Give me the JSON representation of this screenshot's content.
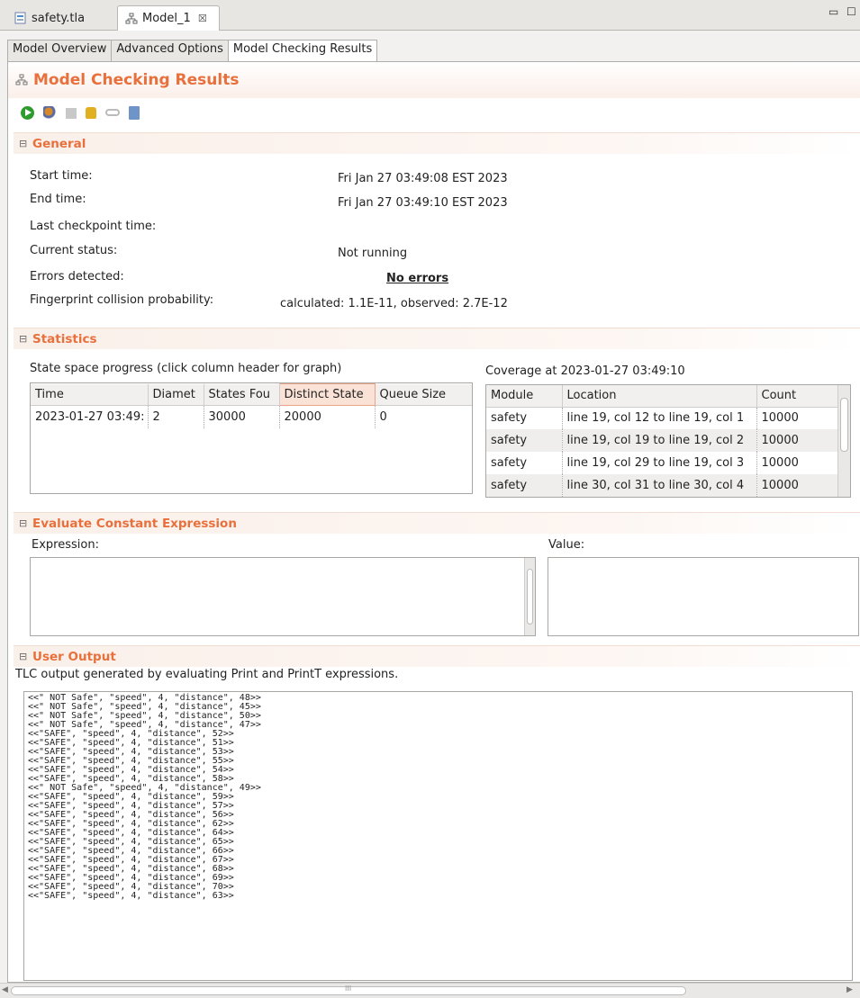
{
  "editor_tabs": [
    {
      "label": "safety.tla",
      "icon": "tla-file-icon"
    },
    {
      "label": "Model_1",
      "icon": "model-icon",
      "close": "☒"
    }
  ],
  "window_controls": {
    "minimize": "▭",
    "maximize": "☐"
  },
  "page_tabs": [
    "Model Overview",
    "Advanced Options",
    "Model Checking Results"
  ],
  "form_title": "Model Checking Results",
  "toolbar": [
    "run-icon",
    "gears-icon",
    "stop-icon",
    "lock-icon",
    "key-icon",
    "report-icon"
  ],
  "general": {
    "title": "General",
    "start_time_label": "Start time:",
    "start_time": "Fri Jan 27 03:49:08 EST 2023",
    "end_time_label": "End time:",
    "end_time": "Fri Jan 27 03:49:10 EST 2023",
    "last_checkpoint_label": "Last checkpoint time:",
    "current_status_label": "Current status:",
    "current_status": "Not running",
    "errors_label": "Errors detected:",
    "errors": "No errors",
    "fingerprint_label": "Fingerprint collision probability:",
    "fingerprint": "calculated: 1.1E-11,  observed: 2.7E-12"
  },
  "statistics": {
    "title": "Statistics",
    "progress_title": "State space progress (click column header for graph)",
    "progress_headers": [
      "Time",
      "Diamet",
      "States Fou",
      "Distinct State",
      "Queue Size"
    ],
    "progress_rows": [
      [
        "2023-01-27 03:49:",
        "2",
        "30000",
        "20000",
        "0"
      ]
    ],
    "coverage_title": "Coverage at  2023-01-27 03:49:10",
    "coverage_headers": [
      "Module",
      "Location",
      "Count"
    ],
    "coverage_rows": [
      [
        "safety",
        "line 19, col 12 to line 19, col 1",
        "10000"
      ],
      [
        "safety",
        "line 19, col 19 to line 19, col 2",
        "10000"
      ],
      [
        "safety",
        "line 19, col 29 to line 19, col 3",
        "10000"
      ],
      [
        "safety",
        "line 30, col 31 to line 30, col 4",
        "10000"
      ]
    ]
  },
  "evaluate": {
    "title": "Evaluate Constant Expression",
    "expression_label": "Expression:",
    "value_label": "Value:"
  },
  "user_output": {
    "title": "User Output",
    "description": "TLC output generated by evaluating Print and PrintT expressions.",
    "lines": [
      "<<\" NOT Safe\", \"speed\", 4, \"distance\", 48>>",
      "<<\" NOT Safe\", \"speed\", 4, \"distance\", 45>>",
      "<<\" NOT Safe\", \"speed\", 4, \"distance\", 50>>",
      "<<\" NOT Safe\", \"speed\", 4, \"distance\", 47>>",
      "<<\"SAFE\", \"speed\", 4, \"distance\", 52>>",
      "<<\"SAFE\", \"speed\", 4, \"distance\", 51>>",
      "<<\"SAFE\", \"speed\", 4, \"distance\", 53>>",
      "<<\"SAFE\", \"speed\", 4, \"distance\", 55>>",
      "<<\"SAFE\", \"speed\", 4, \"distance\", 54>>",
      "<<\"SAFE\", \"speed\", 4, \"distance\", 58>>",
      "<<\" NOT Safe\", \"speed\", 4, \"distance\", 49>>",
      "<<\"SAFE\", \"speed\", 4, \"distance\", 59>>",
      "<<\"SAFE\", \"speed\", 4, \"distance\", 57>>",
      "<<\"SAFE\", \"speed\", 4, \"distance\", 56>>",
      "<<\"SAFE\", \"speed\", 4, \"distance\", 62>>",
      "<<\"SAFE\", \"speed\", 4, \"distance\", 64>>",
      "<<\"SAFE\", \"speed\", 4, \"distance\", 65>>",
      "<<\"SAFE\", \"speed\", 4, \"distance\", 66>>",
      "<<\"SAFE\", \"speed\", 4, \"distance\", 67>>",
      "<<\"SAFE\", \"speed\", 4, \"distance\", 68>>",
      "<<\"SAFE\", \"speed\", 4, \"distance\", 69>>",
      "<<\"SAFE\", \"speed\", 4, \"distance\", 70>>",
      "<<\"SAFE\", \"speed\", 4, \"distance\", 63>>"
    ]
  },
  "scrollbar": {
    "grip": "III"
  }
}
